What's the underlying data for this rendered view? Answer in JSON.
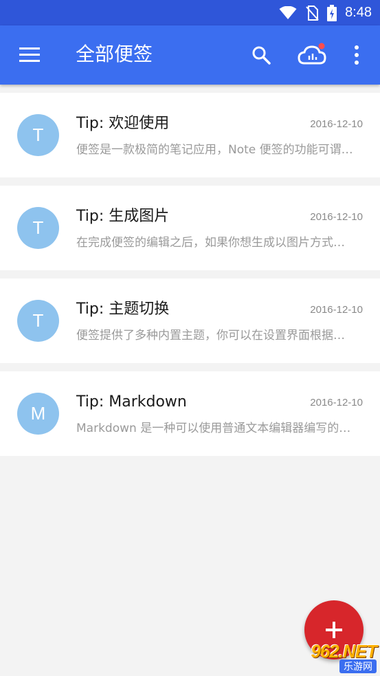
{
  "status_bar": {
    "time": "8:48",
    "icons": [
      "wifi-icon",
      "no-sim-icon",
      "battery-charging-icon"
    ]
  },
  "app_bar": {
    "title": "全部便签",
    "icons": [
      "menu-icon",
      "search-icon",
      "cloud-sync-icon",
      "more-vert-icon"
    ],
    "colors": {
      "status": "#2f56d9",
      "bar": "#3b6ef0",
      "badge": "#ff4d4d"
    }
  },
  "notes": [
    {
      "avatar": "T",
      "title": "Tip: 欢迎使用",
      "date": "2016-12-10",
      "preview": "便签是一款极简的笔记应用，Note 便签的功能可谓…"
    },
    {
      "avatar": "T",
      "title": "Tip: 生成图片",
      "date": "2016-12-10",
      "preview": "在完成便签的编辑之后，如果你想生成以图片方式…"
    },
    {
      "avatar": "T",
      "title": "Tip: 主题切换",
      "date": "2016-12-10",
      "preview": "便签提供了多种内置主题，你可以在设置界面根据…"
    },
    {
      "avatar": "M",
      "title": "Tip: Markdown",
      "date": "2016-12-10",
      "preview": "Markdown 是一种可以使用普通文本编辑器编写的…"
    }
  ],
  "fab": {
    "icon": "plus-icon",
    "color": "#d7262b"
  },
  "watermark": {
    "main": "962.NET",
    "sub": "乐游网"
  }
}
